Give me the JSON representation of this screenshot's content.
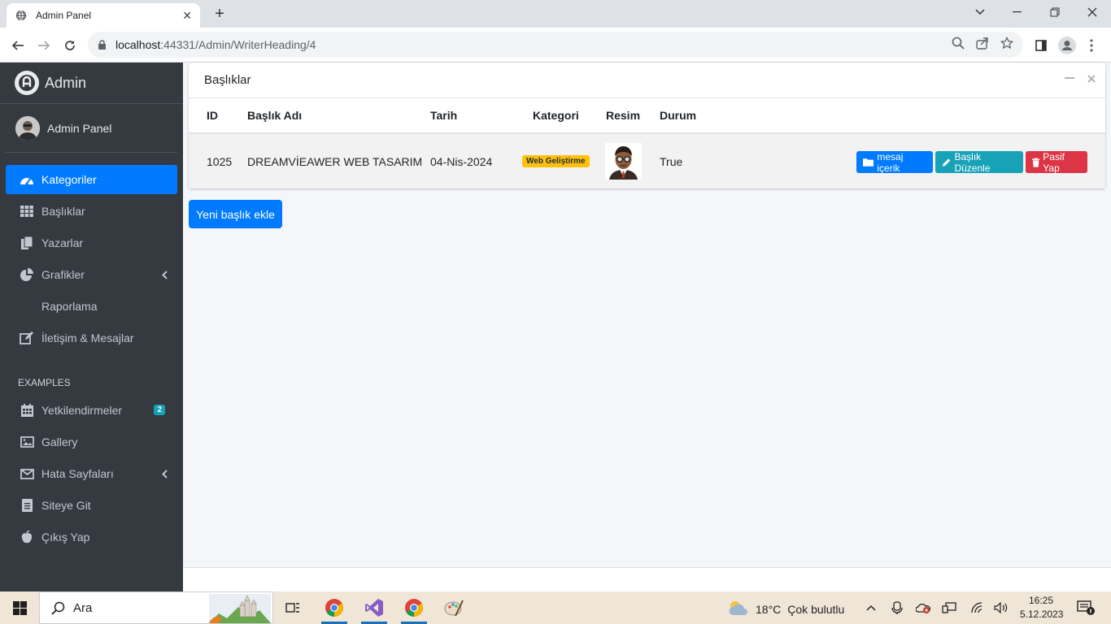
{
  "browser": {
    "tab_title": "Admin Panel",
    "url_host": "localhost",
    "url_path": ":44331/Admin/WriterHeading/4"
  },
  "sidebar": {
    "brand": "Admin",
    "user": "Admin Panel",
    "items": [
      {
        "label": "Kategoriler",
        "icon": "dashboard-icon"
      },
      {
        "label": "Başlıklar",
        "icon": "grid-icon"
      },
      {
        "label": "Yazarlar",
        "icon": "copy-icon"
      },
      {
        "label": "Grafikler",
        "icon": "pie-chart-icon"
      },
      {
        "label": "Raporlama",
        "icon": ""
      },
      {
        "label": "İletişim & Mesajlar",
        "icon": "edit-icon"
      }
    ],
    "section_header": "EXAMPLES",
    "examples": [
      {
        "label": "Yetkilendirmeler",
        "icon": "calendar-icon",
        "badge": "2"
      },
      {
        "label": "Gallery",
        "icon": "image-icon"
      },
      {
        "label": "Hata Sayfaları",
        "icon": "envelope-icon"
      },
      {
        "label": "Siteye Git",
        "icon": "file-icon"
      },
      {
        "label": "Çıkış Yap",
        "icon": "apple-icon"
      }
    ]
  },
  "card": {
    "title": "Başlıklar",
    "columns": [
      "ID",
      "Başlık Adı",
      "Tarih",
      "Kategori",
      "Resim",
      "Durum"
    ],
    "rows": [
      {
        "id": "1025",
        "name": "DREAMVİEAWER WEB TASARIM",
        "date": "04-Nis-2024",
        "category": "Web Geliştirme",
        "status": "True"
      }
    ],
    "buttons": {
      "message": "mesaj içerik",
      "edit": "Başlık Düzenle",
      "passive": "Pasif Yap"
    }
  },
  "add_button": "Yeni başlık ekle",
  "taskbar": {
    "search": "Ara",
    "temp": "18°C",
    "weather": "Çok bulutlu",
    "time": "16:25",
    "date": "5.12.2023"
  },
  "colors": {
    "primary": "#007bff",
    "info": "#17a2b8",
    "danger": "#dc3545",
    "warning": "#ffc107",
    "sidebar": "#343a40"
  }
}
